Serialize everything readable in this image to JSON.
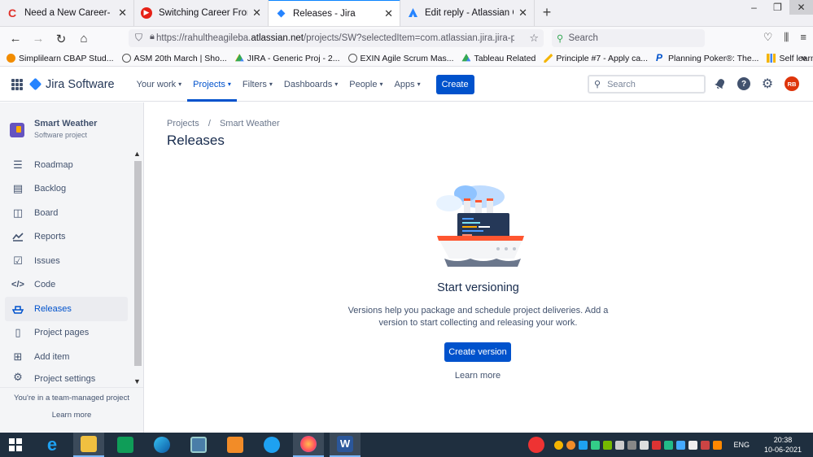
{
  "browser": {
    "tabs": [
      {
        "title": "Need a New Career- How to Ch",
        "icon": "coursera-c-icon",
        "color": "#e0322b"
      },
      {
        "title": "Switching Career From Sales To",
        "icon": "youtube-icon",
        "color": "#e62117"
      },
      {
        "title": "Releases - Jira",
        "icon": "jira-icon",
        "color": "#2684ff",
        "active": true
      },
      {
        "title": "Edit reply - Atlassian Communi",
        "icon": "atlassian-icon",
        "color": "#2684ff"
      }
    ],
    "url_prefix": "https://rahultheagileba.",
    "url_domain": "atlassian.net",
    "url_rest": "/projects/SW?selectedItem=com.atlassian.jira.jira-projects-plugi",
    "search_placeholder": "Search",
    "bookmarks": [
      {
        "label": "Simplilearn CBAP Stud...",
        "color": "#f28c00"
      },
      {
        "label": "ASM 20th March | Sho...",
        "color": "#555555"
      },
      {
        "label": "JIRA - Generic Proj - 2...",
        "color": "#34a853"
      },
      {
        "label": "EXIN Agile Scrum Mas...",
        "color": "#555555"
      },
      {
        "label": "Tableau Related",
        "color": "#34a853"
      },
      {
        "label": "Principle #7 - Apply ca...",
        "color": "#f4b400"
      },
      {
        "label": "Planning Poker®: The...",
        "color": "#0052cc"
      },
      {
        "label": "Self learning",
        "color": "#f4b400"
      }
    ]
  },
  "jira": {
    "product": "Jira Software",
    "nav": [
      {
        "label": "Your work",
        "active": false
      },
      {
        "label": "Projects",
        "active": true
      },
      {
        "label": "Filters",
        "active": false
      },
      {
        "label": "Dashboards",
        "active": false
      },
      {
        "label": "People",
        "active": false
      },
      {
        "label": "Apps",
        "active": false
      }
    ],
    "create_label": "Create",
    "search_placeholder": "Search",
    "avatar_initials": "RB"
  },
  "sidebar": {
    "project_name": "Smart Weather",
    "project_type": "Software project",
    "items": [
      {
        "label": "Roadmap",
        "icon": "roadmap-icon"
      },
      {
        "label": "Backlog",
        "icon": "backlog-icon"
      },
      {
        "label": "Board",
        "icon": "board-icon"
      },
      {
        "label": "Reports",
        "icon": "reports-icon"
      },
      {
        "label": "Issues",
        "icon": "issues-icon"
      },
      {
        "label": "Code",
        "icon": "code-icon"
      },
      {
        "label": "Releases",
        "icon": "releases-icon",
        "active": true
      },
      {
        "label": "Project pages",
        "icon": "pages-icon"
      },
      {
        "label": "Add item",
        "icon": "add-item-icon"
      },
      {
        "label": "Project settings",
        "icon": "settings-icon"
      }
    ],
    "footer_text": "You're in a team-managed project",
    "footer_link": "Learn more"
  },
  "main": {
    "breadcrumb_root": "Projects",
    "breadcrumb_sep": "/",
    "breadcrumb_project": "Smart Weather",
    "title": "Releases",
    "empty_title": "Start versioning",
    "empty_desc": "Versions help you package and schedule project deliveries. Add a version to start collecting and releasing your work.",
    "cta": "Create version",
    "learn_more": "Learn more"
  },
  "taskbar": {
    "lang": "ENG",
    "time": "20:38",
    "date": "10-06-2021"
  }
}
